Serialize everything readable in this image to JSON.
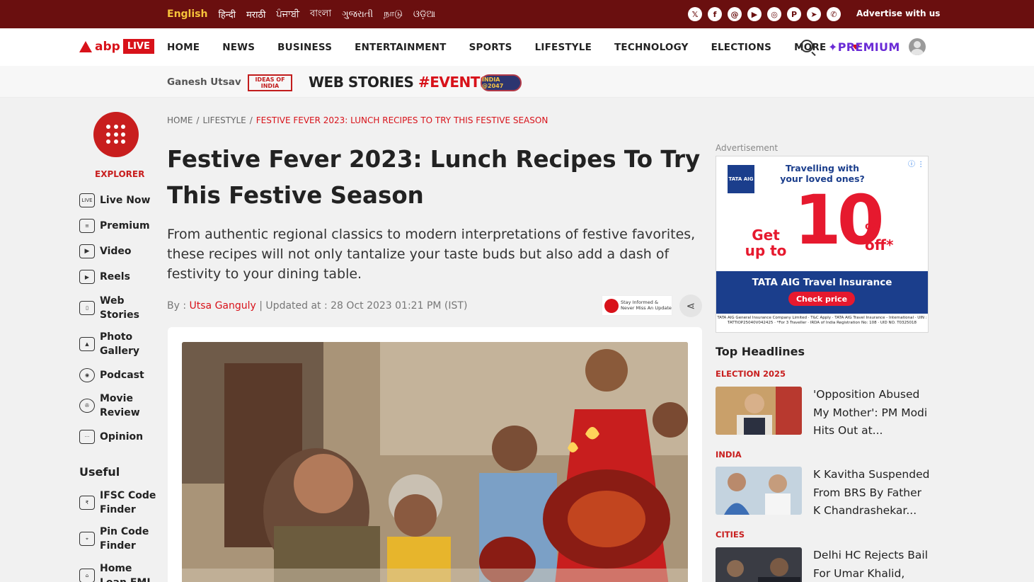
{
  "top_bar": {
    "languages": [
      "English",
      "हिन्दी",
      "मराठी",
      "ਪੰਜਾਬੀ",
      "বাংলা",
      "ગુજરાતી",
      "நாடு",
      "ଓଡ଼ିଆ"
    ],
    "socials": [
      "x-icon",
      "facebook-icon",
      "threads-icon",
      "youtube-icon",
      "instagram-icon",
      "pinterest-icon",
      "telegram-icon",
      "whatsapp-icon"
    ],
    "advertise": "Advertise with us"
  },
  "nav": {
    "logo_abp": "abp",
    "logo_live": "LIVE",
    "items": [
      "HOME",
      "NEWS",
      "BUSINESS",
      "ENTERTAINMENT",
      "SPORTS",
      "LIFESTYLE",
      "TECHNOLOGY",
      "ELECTIONS",
      "MORE"
    ],
    "premium": "✦PREMIUM"
  },
  "subbar": {
    "ganesh": "Ganesh Utsav",
    "ideas": "IDEAS OF INDIA",
    "web_stories": "WEB STORIES",
    "events": "#EVENTS",
    "india_2047": "INDIA @2047"
  },
  "sidebar": {
    "explorer": "EXPLORER",
    "items": [
      {
        "label": "Live Now",
        "icon": "live-icon"
      },
      {
        "label": "Premium",
        "icon": "premium-icon"
      },
      {
        "label": "Video",
        "icon": "video-icon"
      },
      {
        "label": "Reels",
        "icon": "reels-icon"
      },
      {
        "label": "Web\nStories",
        "icon": "web-stories-icon"
      },
      {
        "label": "Photo\nGallery",
        "icon": "photo-gallery-icon"
      },
      {
        "label": "Podcast",
        "icon": "podcast-icon"
      },
      {
        "label": "Movie\nReview",
        "icon": "movie-review-icon"
      },
      {
        "label": "Opinion",
        "icon": "opinion-icon"
      }
    ],
    "useful_title": "Useful",
    "useful_items": [
      {
        "label": "IFSC Code\nFinder",
        "icon": "ifsc-icon"
      },
      {
        "label": "Pin Code\nFinder",
        "icon": "pin-code-icon"
      },
      {
        "label": "Home\nLoan EMI",
        "icon": "home-loan-icon"
      }
    ]
  },
  "article": {
    "breadcrumb": [
      "HOME",
      "LIFESTYLE",
      "FESTIVE FEVER 2023: LUNCH RECIPES TO TRY THIS FESTIVE SEASON"
    ],
    "headline": "Festive Fever 2023: Lunch Recipes To Try This Festive Season",
    "dek": "From authentic regional classics to modern interpretations of festive favorites, these recipes will not only tantalize your taste buds but also add a dash of festivity to your dining table.",
    "by_prefix": "By : ",
    "author": "Utsa Ganguly",
    "updated": " | Updated at : 28 Oct 2023 01:21 PM (IST)",
    "app_badge": "Stay Informed & Never Miss An Update"
  },
  "ad": {
    "label": "Advertisement",
    "brand": "TATA AIG",
    "travelling": "Travelling with your loved ones?",
    "get_up_to": "Get up to",
    "value": "10",
    "off": "% off*",
    "insurance": "TATA AIG Travel Insurance",
    "cta": "Check price",
    "fine_print": "TATA AIG General Insurance Company Limited · T&C Apply · TATA AIG Travel Insurance - International · UIN : TATTIOP25040V042425 · *For 3 Traveller · IRDA of India Registration No: 108 · UID NO. T0325018"
  },
  "headlines": {
    "title": "Top Headlines",
    "items": [
      {
        "category": "ELECTION 2025",
        "text": "'Opposition Abused My Mother': PM Modi Hits Out at..."
      },
      {
        "category": "INDIA",
        "text": "K Kavitha Suspended From BRS By Father K Chandrashekar..."
      },
      {
        "category": "CITIES",
        "text": "Delhi HC Rejects Bail For Umar Khalid,"
      }
    ]
  }
}
